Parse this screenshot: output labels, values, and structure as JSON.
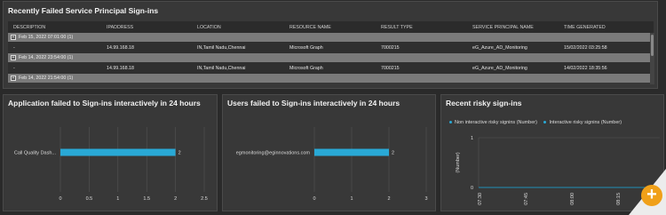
{
  "top_panel": {
    "title": "Recently Failed Service Principal Sign-ins",
    "columns": [
      "DESCRIPTION",
      "IPADDRESS",
      "LOCATION",
      "RESOURCE NAME",
      "RESULT TYPE",
      "SERVICE PRINCIPAL NAME",
      "TIME GENERATED"
    ],
    "groups": [
      {
        "expander": "+",
        "label": "Feb 15, 2022 07:01:00 (1)",
        "row": {
          "description": "-",
          "ipaddress": "14.99.168.18",
          "location": "IN,Tamil Nadu,Chennai",
          "resource": "Microsoft Graph",
          "result": "7000215",
          "principal": "eG_Azure_AD_Monitoring",
          "time": "15/02/2022 03:25:58"
        }
      },
      {
        "expander": "+",
        "label": "Feb 14, 2022 23:54:00 (1)",
        "row": {
          "description": "-",
          "ipaddress": "14.99.168.18",
          "location": "IN,Tamil Nadu,Chennai",
          "resource": "Microsoft Graph",
          "result": "7000215",
          "principal": "eG_Azure_AD_Monitoring",
          "time": "14/02/2022 18:35:56"
        }
      },
      {
        "expander": "+",
        "label": "Feb 14, 2022 21:54:00 (1)"
      }
    ]
  },
  "panel_apps": {
    "title": "Application failed to Sign-ins interactively in 24 hours"
  },
  "panel_users": {
    "title": "Users failed to Sign-ins interactively in 24 hours"
  },
  "panel_risky": {
    "title": "Recent risky sign-ins",
    "legend": [
      "Non interactive risky signins (Number)",
      "Interactive risky signins (Number)"
    ]
  },
  "fab": {
    "icon": "plus-icon",
    "label": "+"
  },
  "colors": {
    "accent": "#29a9d6",
    "fab": "#f0a019",
    "panel": "#383838"
  },
  "chart_data": [
    {
      "type": "bar",
      "orientation": "horizontal",
      "categories": [
        "Call Quality Dash..."
      ],
      "values": [
        2
      ],
      "value_labels": [
        "2"
      ],
      "xlim": [
        0,
        2.5
      ],
      "xticks": [
        "0",
        "0.5",
        "1",
        "1.5",
        "2",
        "2.5"
      ],
      "grid": true
    },
    {
      "type": "bar",
      "orientation": "horizontal",
      "categories": [
        "egmonitoring@eginnovations.com"
      ],
      "values": [
        2
      ],
      "value_labels": [
        "2"
      ],
      "xlim": [
        0,
        3
      ],
      "xticks": [
        "0",
        "1",
        "2",
        "3"
      ],
      "grid": true
    },
    {
      "type": "line",
      "ylabel": "(Number)",
      "ylim": [
        0,
        1
      ],
      "yticks": [
        "0",
        "1"
      ],
      "xticks": [
        "07:30",
        "07:45",
        "08:00",
        "08:15"
      ],
      "series": [
        {
          "name": "Non interactive risky signins (Number)",
          "values": [
            0,
            0,
            0,
            0
          ]
        },
        {
          "name": "Interactive risky signins (Number)",
          "values": [
            0,
            0,
            0,
            0
          ]
        }
      ],
      "legend_position": "top-left"
    }
  ]
}
